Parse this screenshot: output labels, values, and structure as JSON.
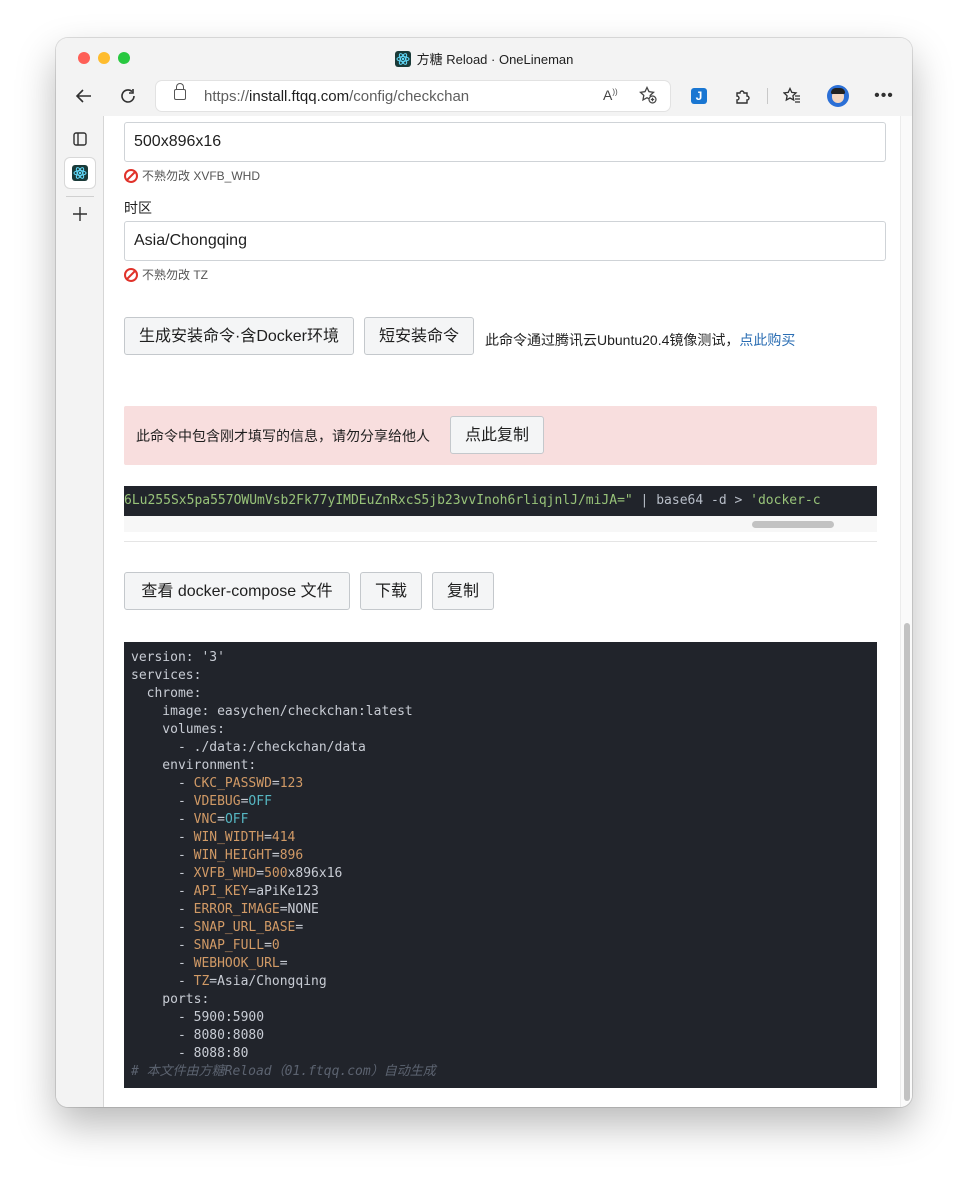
{
  "browser": {
    "tab_title": "方糖 Reload · OneLineman",
    "url_prefix": "https://",
    "url_host": "install.ftqq.com",
    "url_path": "/config/checkchan"
  },
  "form": {
    "resolution_value": "500x896x16",
    "resolution_hint": "不熟勿改 XVFB_WHD",
    "tz_label": "时区",
    "tz_value": "Asia/Chongqing",
    "tz_hint": "不熟勿改 TZ"
  },
  "actions": {
    "generate_label": "生成安装命令·含Docker环境",
    "short_label": "短安装命令",
    "note_text": "此命令通过腾讯云Ubuntu20.4镜像测试，",
    "note_link": "点此购买"
  },
  "alert": {
    "text": "此命令中包含刚才填写的信息，请勿分享给他人",
    "copy_label": "点此复制"
  },
  "command": {
    "string_part": "6Lu255Sx5pa557OWUmVsb2Fk77yIMDEuZnRxcS5jb23vvInoh6rliqjnlJ/miJA=\"",
    "pipe_part": " | base64 -d  > ",
    "tail_part": "'docker-c"
  },
  "compose": {
    "view_label": "查看 docker-compose 文件",
    "download_label": "下载",
    "copy_label": "复制"
  },
  "code": {
    "l01": "version: '3'",
    "l02": "services:",
    "l03": "  chrome:",
    "l04": "    image: easychen/checkchan:latest",
    "l05": "    volumes:",
    "l06": "      - ./data:/checkchan/data",
    "l07": "    environment:",
    "env": [
      {
        "key": "CKC_PASSWD",
        "val": "123"
      },
      {
        "key": "VDEBUG",
        "val": "OFF"
      },
      {
        "key": "VNC",
        "val": "OFF"
      },
      {
        "key": "WIN_WIDTH",
        "val": "414"
      },
      {
        "key": "WIN_HEIGHT",
        "val": "896"
      },
      {
        "key": "XVFB_WHD",
        "val_a": "500",
        "val_b": "x896x16"
      },
      {
        "key": "API_KEY",
        "val": "aPiKe123"
      },
      {
        "key": "ERROR_IMAGE",
        "val": "NONE"
      },
      {
        "key": "SNAP_URL_BASE",
        "val": ""
      },
      {
        "key": "SNAP_FULL",
        "val": "0"
      },
      {
        "key": "WEBHOOK_URL",
        "val": ""
      },
      {
        "key": "TZ",
        "val": "Asia/Chongqing"
      }
    ],
    "l20": "    ports:",
    "l21": "      - 5900:5900",
    "l22": "      - 8080:8080",
    "l23": "      - 8088:80",
    "comment": "# 本文件由方糖Reload（01.ftqq.com）自动生成"
  },
  "colors": {
    "accent_link": "#2a6db3",
    "alert_bg": "#f8dede",
    "code_bg": "#21242b"
  }
}
